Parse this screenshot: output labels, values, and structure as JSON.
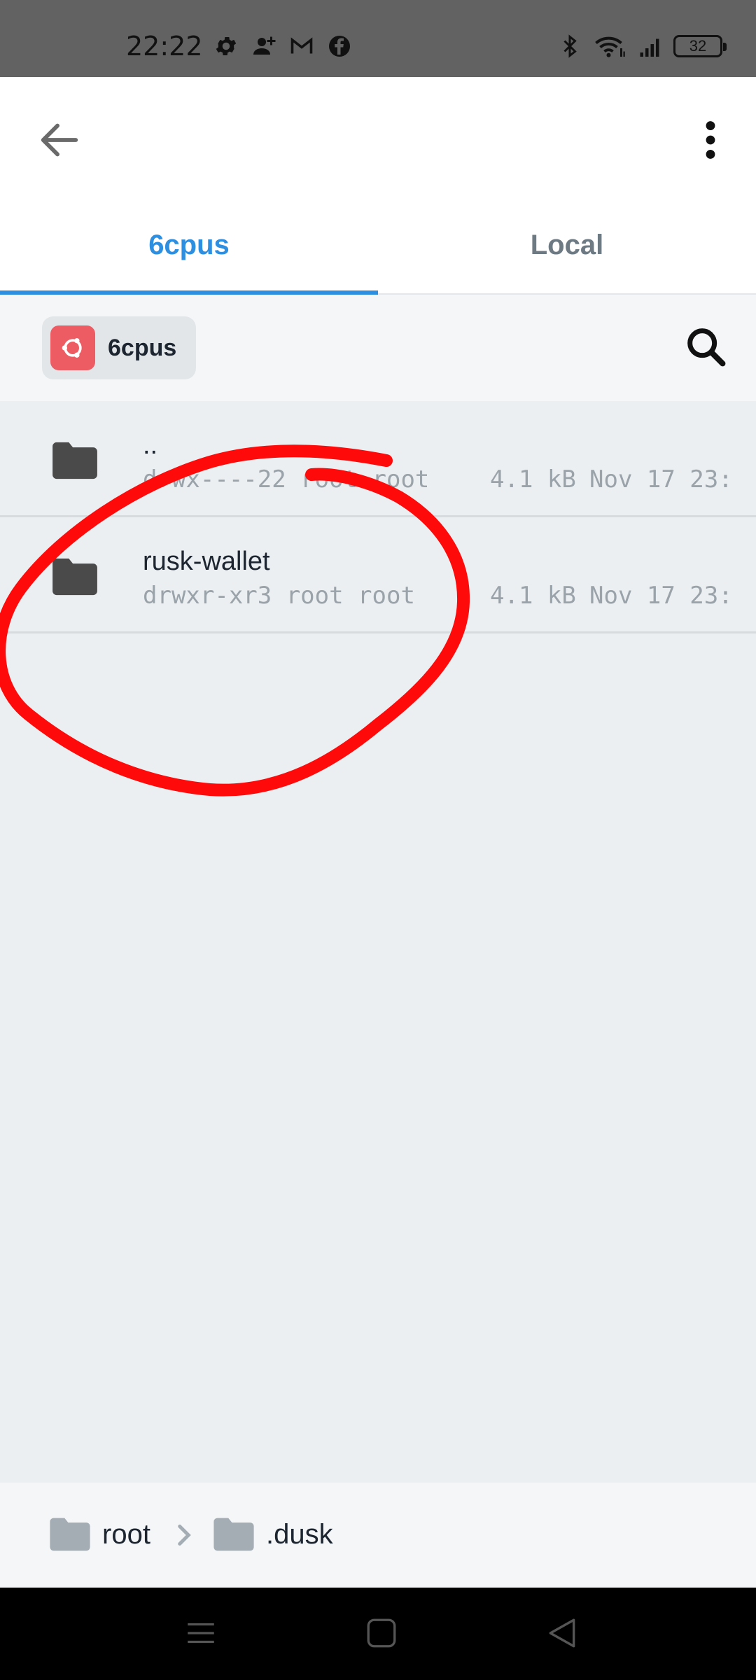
{
  "status_bar": {
    "time": "22:22",
    "left_icons": [
      "settings-icon",
      "person-add-icon",
      "gmail-icon",
      "facebook-icon"
    ],
    "right_icons": [
      "bluetooth-icon",
      "wifi-icon",
      "signal-icon"
    ],
    "battery": "32"
  },
  "app_bar": {
    "back_icon": "arrow-back-icon",
    "menu_icon": "more-vert-icon"
  },
  "tabs": [
    {
      "label": "6cpus",
      "active": true
    },
    {
      "label": "Local",
      "active": false
    }
  ],
  "host": {
    "name": "6cpus",
    "logo_icon": "ubuntu-icon",
    "search_icon": "search-icon"
  },
  "files": [
    {
      "name": "..",
      "permissions": "drwx----22 root root",
      "size": "4.1 kB",
      "date": "Nov 17 23:"
    },
    {
      "name": "rusk-wallet",
      "permissions": "drwxr-xr3 root root",
      "size": "4.1 kB",
      "date": "Nov 17 23:"
    }
  ],
  "breadcrumb": [
    {
      "label": "root"
    },
    {
      "label": ".dusk"
    }
  ],
  "colors": {
    "accent": "#2e8fe0",
    "annotation": "#ff0000",
    "host_logo": "#ee5c63"
  }
}
